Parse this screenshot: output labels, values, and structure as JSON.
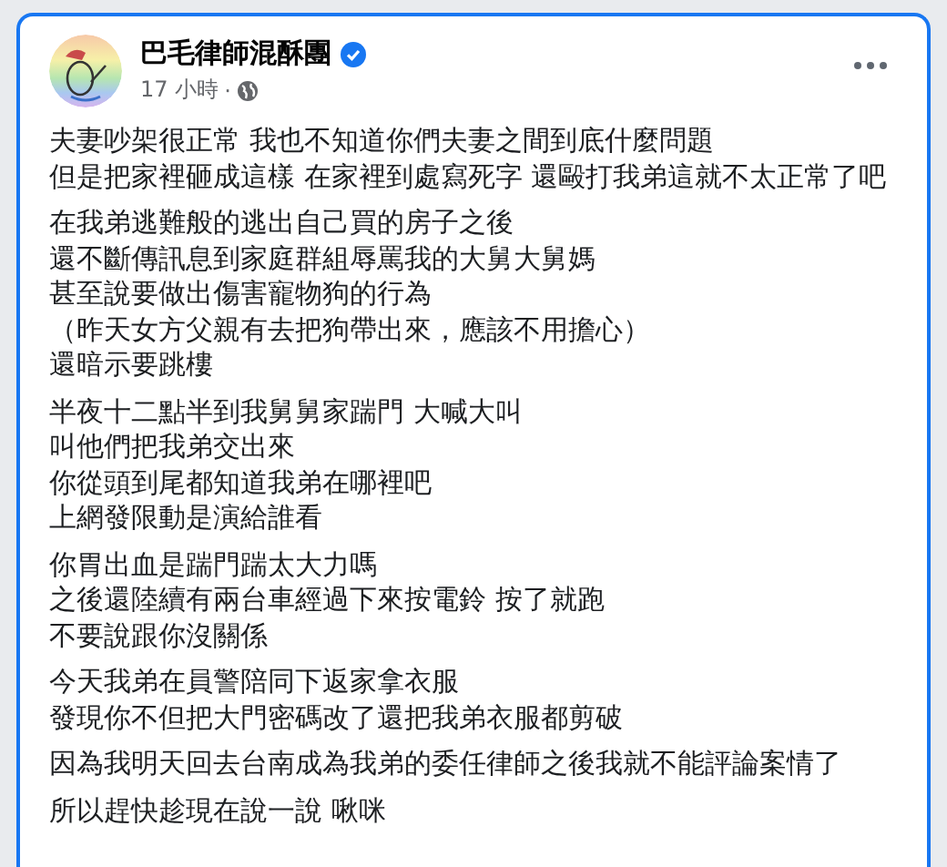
{
  "post": {
    "author": "巴毛律師混酥團",
    "verified": true,
    "time": "17 小時",
    "separator": "·",
    "paragraphs": [
      {
        "lines": [
          "夫妻吵架很正常 我也不知道你們夫妻之間到底什麼問題",
          "但是把家裡砸成這樣 在家裡到處寫死字 還毆打我弟這就不太正常了吧"
        ]
      },
      {
        "lines": [
          "在我弟逃難般的逃出自己買的房子之後",
          "還不斷傳訊息到家庭群組辱罵我的大舅大舅媽",
          "甚至說要做出傷害寵物狗的行為",
          "（昨天女方父親有去把狗帶出來，應該不用擔心）",
          "還暗示要跳樓"
        ]
      },
      {
        "lines": [
          "半夜十二點半到我舅舅家踹門 大喊大叫",
          "叫他們把我弟交出來",
          "你從頭到尾都知道我弟在哪裡吧",
          "上網發限動是演給誰看"
        ]
      },
      {
        "lines": [
          "你胃出血是踹門踹太大力嗎",
          "之後還陸續有兩台車經過下來按電鈴 按了就跑",
          "不要說跟你沒關係"
        ]
      },
      {
        "lines": [
          "今天我弟在員警陪同下返家拿衣服",
          "發現你不但把大門密碼改了還把我弟衣服都剪破"
        ]
      },
      {
        "lines": [
          "因為我明天回去台南成為我弟的委任律師之後我就不能評論案情了"
        ]
      },
      {
        "lines": [
          "所以趕快趁現在說一說 啾咪"
        ]
      }
    ]
  }
}
